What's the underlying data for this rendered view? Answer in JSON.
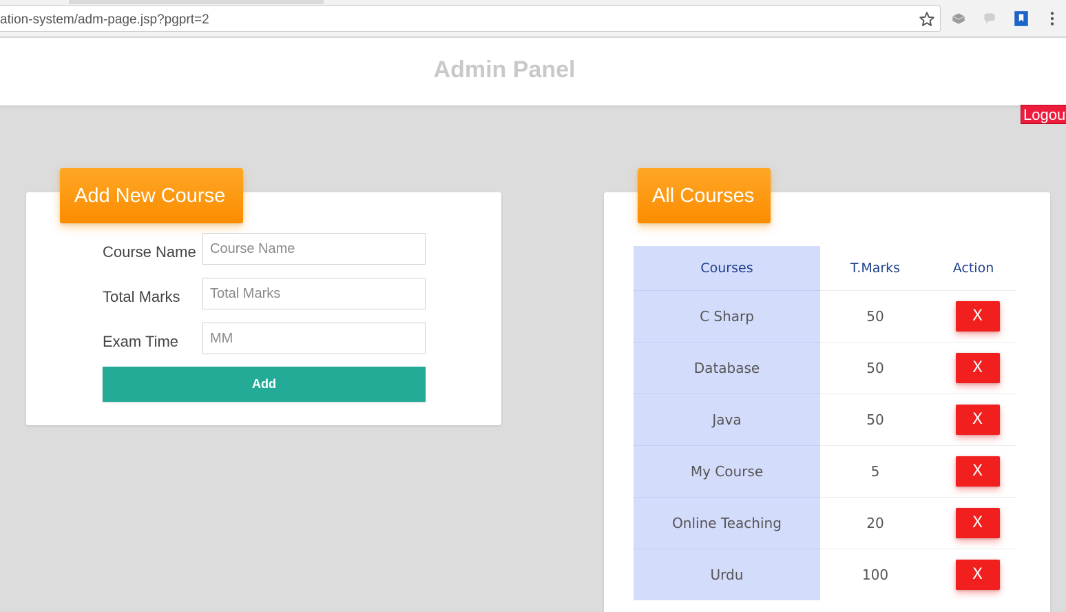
{
  "browser": {
    "url": "ation-system/adm-page.jsp?pgprt=2"
  },
  "header": {
    "title": "Admin Panel",
    "logout_label": "Logout"
  },
  "add_course": {
    "heading": "Add New Course",
    "fields": [
      {
        "label": "Course Name",
        "placeholder": "Course Name"
      },
      {
        "label": "Total Marks",
        "placeholder": "Total Marks"
      },
      {
        "label": "Exam Time",
        "placeholder": "MM"
      }
    ],
    "submit_label": "Add"
  },
  "all_courses": {
    "heading": "All Courses",
    "columns": [
      "Courses",
      "T.Marks",
      "Action"
    ],
    "rows": [
      {
        "course": "C Sharp",
        "marks": "50",
        "action": "X"
      },
      {
        "course": "Database",
        "marks": "50",
        "action": "X"
      },
      {
        "course": "Java",
        "marks": "50",
        "action": "X"
      },
      {
        "course": "My Course",
        "marks": "5",
        "action": "X"
      },
      {
        "course": "Online Teaching",
        "marks": "20",
        "action": "X"
      },
      {
        "course": "Urdu",
        "marks": "100",
        "action": "X"
      }
    ]
  },
  "colors": {
    "accent_orange": "#fb8c00",
    "add_button": "#23ab97",
    "delete_button": "#f21f1f",
    "logout": "#ee1c3c",
    "course_column": "#d4dcfb"
  }
}
